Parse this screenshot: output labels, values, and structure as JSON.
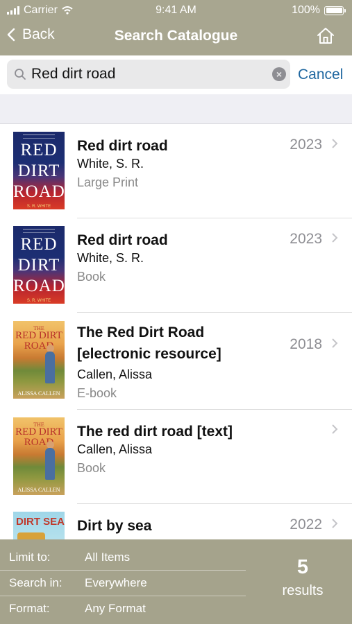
{
  "status": {
    "carrier": "Carrier",
    "time": "9:41 AM",
    "battery": "100%",
    "battery_level": 1.0
  },
  "nav": {
    "back_label": "Back",
    "title": "Search Catalogue",
    "home_icon": "home-icon"
  },
  "search": {
    "value": "Red dirt road",
    "clear_icon": "×",
    "cancel_label": "Cancel"
  },
  "results_list": [
    {
      "title": "Red dirt road",
      "author": "White, S. R.",
      "format": "Large Print",
      "year": "2023",
      "cover": {
        "line1": "RED",
        "line2": "DIRT",
        "line3": "ROAD",
        "author_text": "S. R. WHITE"
      }
    },
    {
      "title": "Red dirt road",
      "author": "White, S. R.",
      "format": "Book",
      "year": "2023",
      "cover": {
        "line1": "RED",
        "line2": "DIRT",
        "line3": "ROAD",
        "author_text": "S. R. WHITE"
      }
    },
    {
      "title": "The Red Dirt Road [electronic resource]",
      "author": "Callen, Alissa",
      "format": "E-book",
      "year": "2018",
      "cover": {
        "small": "THE",
        "big": "RED DIRT ROAD",
        "author_text": "ALISSA CALLEN"
      }
    },
    {
      "title": "The red dirt road [text]",
      "author": "Callen, Alissa",
      "format": "Book",
      "year": "",
      "cover": {
        "small": "THE",
        "big": "RED DIRT ROAD",
        "author_text": "ALISSA CALLEN"
      }
    },
    {
      "title": "Dirt by sea",
      "author": "",
      "format": "",
      "year": "2022",
      "cover": {
        "big": "DIRT SEA"
      }
    }
  ],
  "filters": [
    {
      "label": "Limit to:",
      "value": "All Items"
    },
    {
      "label": "Search in:",
      "value": "Everywhere"
    },
    {
      "label": "Format:",
      "value": "Any Format"
    }
  ],
  "results_count": {
    "number": "5",
    "label": "results"
  },
  "colors": {
    "header": "#a8a690",
    "footer": "#a5a38c",
    "link": "#1f67a0"
  }
}
